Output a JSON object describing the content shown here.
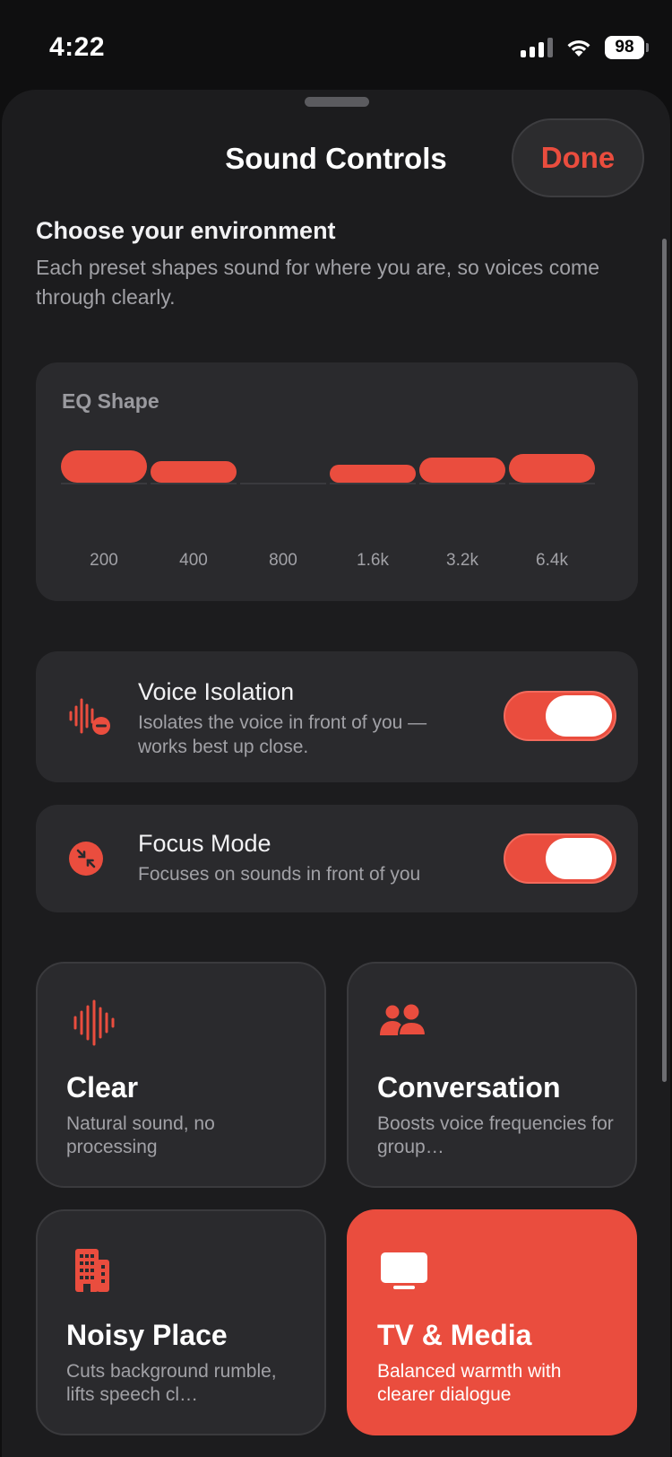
{
  "status": {
    "time": "4:22",
    "battery": "98"
  },
  "header": {
    "title": "Sound Controls",
    "done_label": "Done"
  },
  "environment": {
    "title": "Choose your environment",
    "description": "Each preset shapes sound for where you are, so voices come through clearly."
  },
  "eq": {
    "label": "EQ Shape",
    "bands": [
      {
        "freq": "200",
        "gain": 1.0
      },
      {
        "freq": "400",
        "gain": 0.5
      },
      {
        "freq": "800",
        "gain": 0.0
      },
      {
        "freq": "1.6k",
        "gain": 0.33
      },
      {
        "freq": "3.2k",
        "gain": 0.67
      },
      {
        "freq": "6.4k",
        "gain": 0.83
      }
    ]
  },
  "toggles": {
    "voice_isolation": {
      "title": "Voice Isolation",
      "subtitle": "Isolates the voice in front of you — works best up close.",
      "on": true
    },
    "focus_mode": {
      "title": "Focus Mode",
      "subtitle": "Focuses on sounds in front of you",
      "on": true
    }
  },
  "presets": [
    {
      "title": "Clear",
      "subtitle": "Natural sound, no processing",
      "icon": "waveform-icon",
      "selected": false
    },
    {
      "title": "Conversation",
      "subtitle": "Boosts voice frequencies for group…",
      "icon": "people-icon",
      "selected": false
    },
    {
      "title": "Noisy Place",
      "subtitle": "Cuts background rumble, lifts speech cl…",
      "icon": "building-icon",
      "selected": false
    },
    {
      "title": "TV & Media",
      "subtitle": "Balanced warmth with clearer dialogue",
      "icon": "tv-icon",
      "selected": true
    }
  ],
  "colors": {
    "accent": "#ea4d3e",
    "sheet": "#1c1c1e",
    "card": "#2a2a2d"
  }
}
